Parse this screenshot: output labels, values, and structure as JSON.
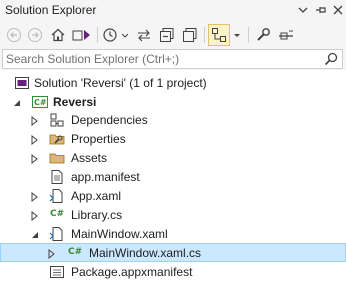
{
  "window": {
    "title": "Solution Explorer",
    "controls": [
      "chevron-down-icon",
      "pin-icon",
      "close-icon"
    ]
  },
  "toolbar": {
    "buttons": [
      "back-icon",
      "forward-icon",
      "home-icon",
      "switch-views-icon",
      "history-icon",
      "sync-icon",
      "collapse-all-icon",
      "show-all-files-icon",
      "preview-selected-icon",
      "properties-icon",
      "settings-icon"
    ]
  },
  "search": {
    "placeholder": "Search Solution Explorer (Ctrl+;)",
    "value": ""
  },
  "colors": {
    "selection": "#cce8ff",
    "active_tool": "#fbf3c9",
    "csharp": "#388a34",
    "project": "#388a34",
    "folder": "#dcb67a"
  },
  "tree": {
    "solution": "Solution 'Reversi' (1 of 1 project)",
    "project": "Reversi",
    "items": [
      {
        "label": "Dependencies",
        "icon": "dependencies-icon"
      },
      {
        "label": "Properties",
        "icon": "properties-folder-icon"
      },
      {
        "label": "Assets",
        "icon": "folder-icon"
      },
      {
        "label": "app.manifest",
        "icon": "manifest-icon"
      },
      {
        "label": "App.xaml",
        "icon": "xaml-icon"
      },
      {
        "label": "Library.cs",
        "icon": "csharp-file-icon"
      },
      {
        "label": "MainWindow.xaml",
        "icon": "xaml-icon"
      },
      {
        "label": "MainWindow.xaml.cs",
        "icon": "csharp-file-icon",
        "selected": true
      },
      {
        "label": "Package.appxmanifest",
        "icon": "package-manifest-icon"
      }
    ]
  }
}
